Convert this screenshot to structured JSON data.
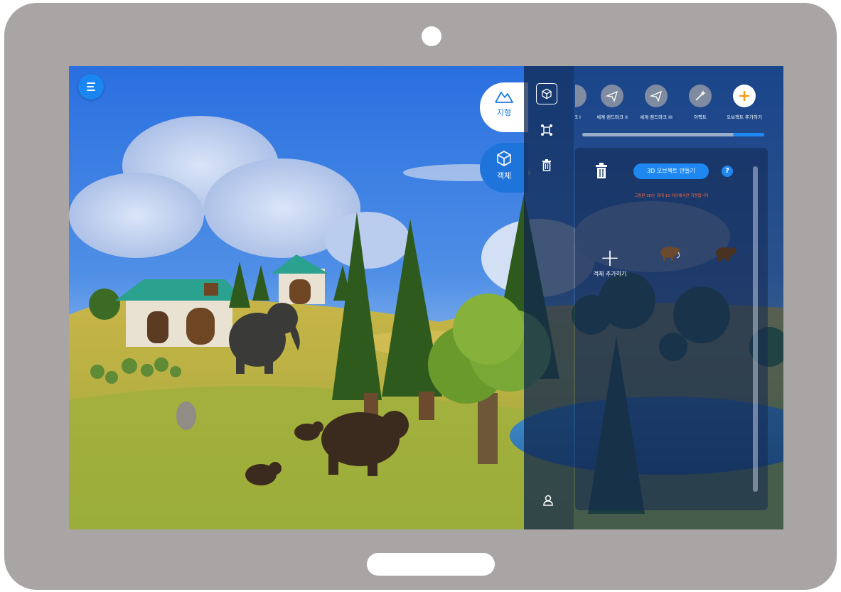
{
  "top_left": {
    "menu_icon": "hamburger-icon"
  },
  "modes": [
    {
      "label": "지형",
      "icon": "mountain-icon",
      "active": false
    },
    {
      "label": "객체",
      "icon": "cube-icon",
      "active": true
    }
  ],
  "rail": {
    "items": [
      {
        "icon": "cube-outline-icon",
        "active": true
      },
      {
        "icon": "transform-icon",
        "active": false
      },
      {
        "icon": "trash-icon",
        "active": false
      }
    ],
    "bottom_icon": "user-icon"
  },
  "categories": [
    {
      "label": "마크 I",
      "icon": "landmark-icon"
    },
    {
      "label": "세계 랜드마크 II",
      "icon": "airplane-icon"
    },
    {
      "label": "세계 랜드마크 III",
      "icon": "airplane-icon"
    },
    {
      "label": "이펙트",
      "icon": "magic-wand-icon"
    },
    {
      "label": "오브젝트 추가하기",
      "icon": "plus-icon"
    }
  ],
  "content": {
    "create_label": "3D 오브젝트 만들기",
    "help_label": "?",
    "notice": "그림판 3D는 최대 10 이상에서만 지원됩니다",
    "add_plus": "+",
    "add_label": "객체 추가하기",
    "thumbnails": [
      "mammoth-thumbnail",
      "bear-thumbnail"
    ]
  },
  "colors": {
    "accent": "#1e88f0",
    "notice": "#ff6a3a",
    "frame": "#a9a5a4"
  }
}
